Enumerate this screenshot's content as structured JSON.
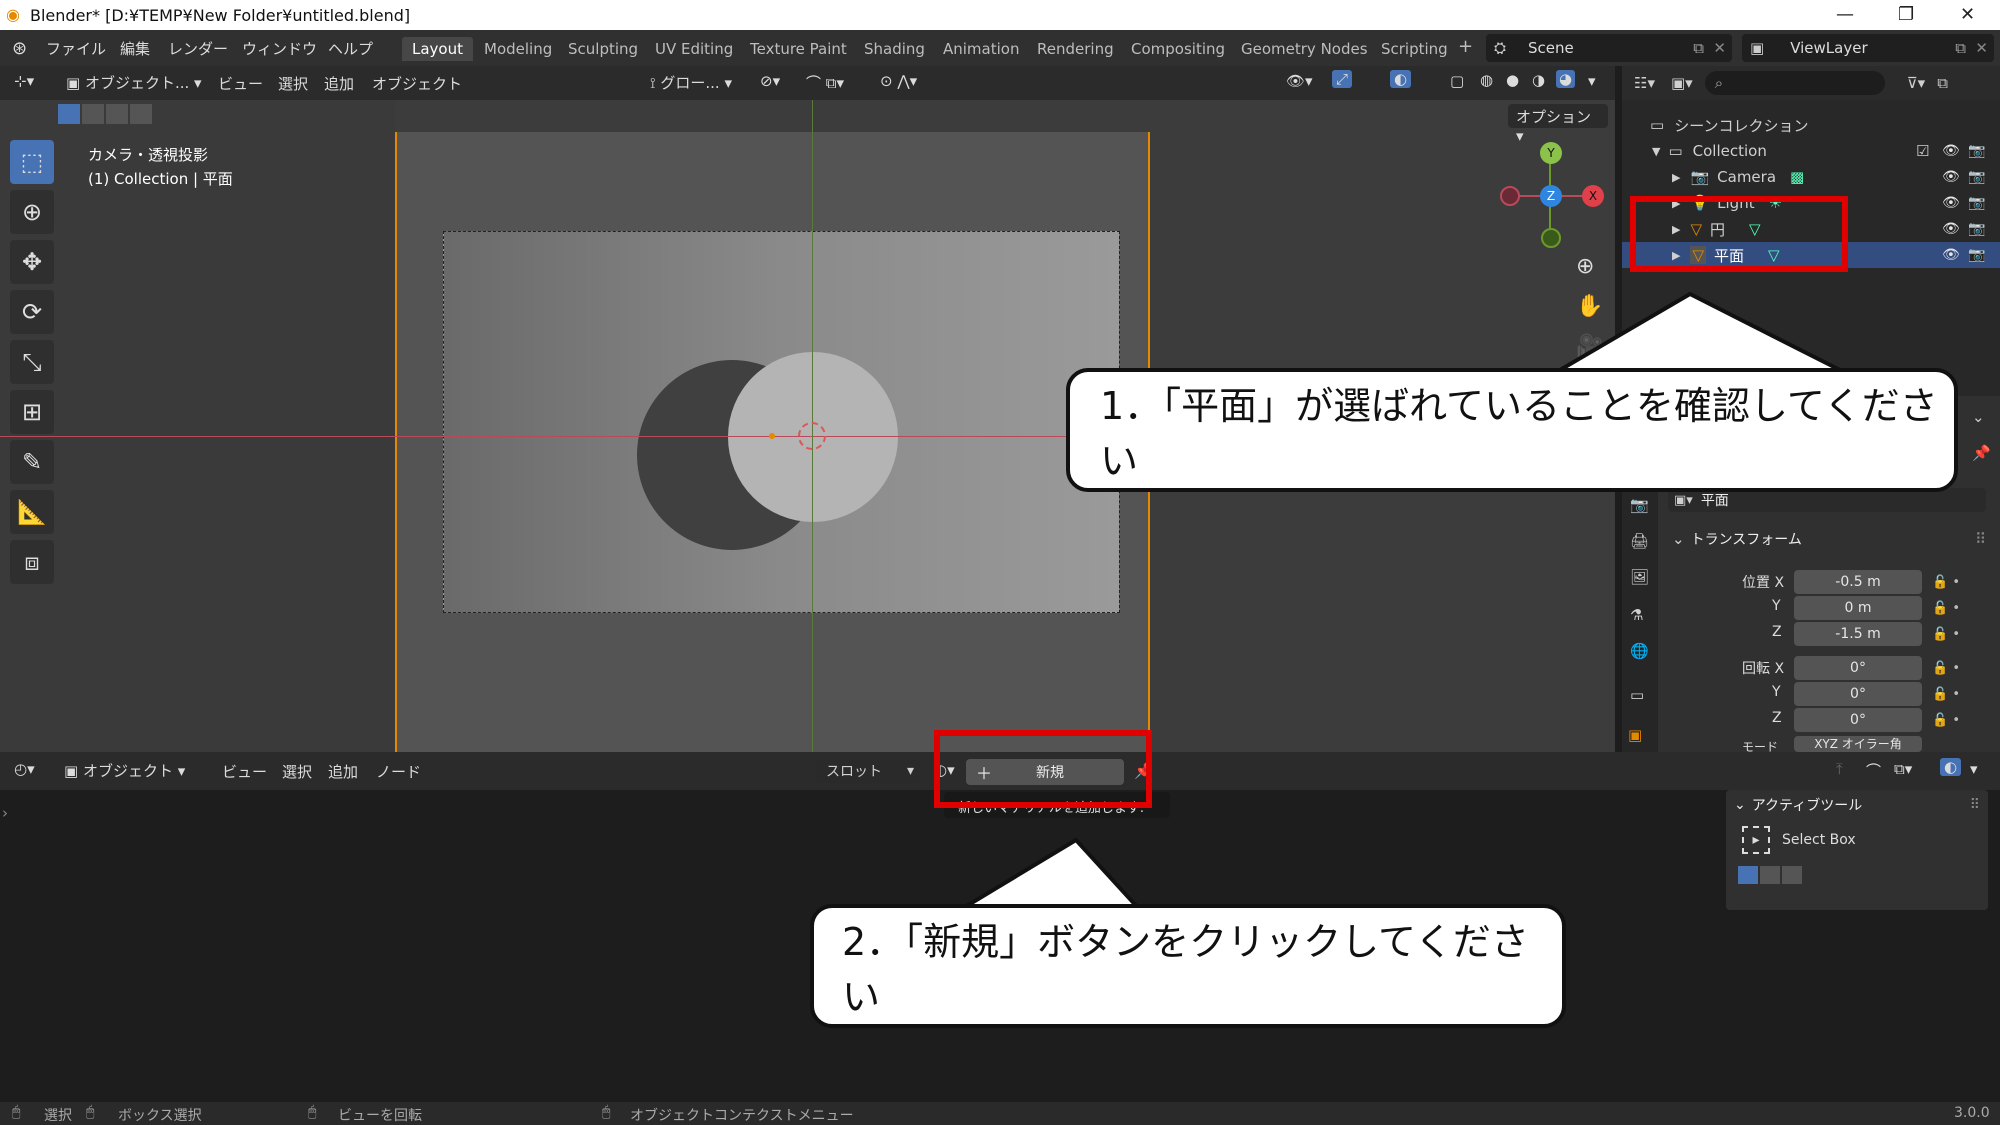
{
  "titlebar": {
    "title": "Blender* [D:¥TEMP¥New Folder¥untitled.blend]",
    "minimize": "—",
    "restore": "❐",
    "close": "✕"
  },
  "menu": {
    "items": [
      "ファイル",
      "編集",
      "レンダー",
      "ウィンドウ",
      "ヘルプ"
    ]
  },
  "workspaces": [
    "Layout",
    "Modeling",
    "Sculpting",
    "UV Editing",
    "Texture Paint",
    "Shading",
    "Animation",
    "Rendering",
    "Compositing",
    "Geometry Nodes",
    "Scripting"
  ],
  "workspace_add": "+",
  "scene": {
    "label": "Scene",
    "viewlayer": "ViewLayer"
  },
  "viewport_header": {
    "mode": "オブジェクト...",
    "view": "ビュー",
    "select": "選択",
    "add": "追加",
    "object": "オブジェクト",
    "transform": "グロー...",
    "options": "オプション"
  },
  "viewport": {
    "info_line1": "カメラ・透視投影",
    "info_line2": "(1) Collection | 平面"
  },
  "gizmo": {
    "y": "Y",
    "z": "Z",
    "x": "X"
  },
  "outliner": {
    "scene_collection": "シーンコレクション",
    "collection": "Collection",
    "items": [
      {
        "name": "Camera"
      },
      {
        "name": "Light"
      },
      {
        "name": "円"
      },
      {
        "name": "平面"
      }
    ]
  },
  "properties": {
    "object_name": "平面",
    "panel": "トランスフォーム",
    "loc_label": "位置 X",
    "rot_label": "回転 X",
    "y": "Y",
    "z": "Z",
    "loc": [
      "-0.5 m",
      "0 m",
      "-1.5 m"
    ],
    "rot": [
      "0°",
      "0°",
      "0°"
    ],
    "mode_label": "モード",
    "mode_value": "XYZ オイラー角"
  },
  "node_header": {
    "mode": "オブジェクト",
    "view": "ビュー",
    "select": "選択",
    "add": "追加",
    "node": "ノード",
    "slot": "スロット",
    "new_button": "新規",
    "tooltip": "新しいマテリアルを追加します."
  },
  "sidebar": {
    "active_tool": "アクティブツール",
    "select_box": "Select Box"
  },
  "status": {
    "select": "選択",
    "box_select": "ボックス選択",
    "rotate_view": "ビューを回転",
    "context_menu": "オブジェクトコンテクストメニュー",
    "version": "3.0.0"
  },
  "callouts": {
    "one": "1．「平面」が選ばれていることを確認してください",
    "two": "2．「新規」ボタンをクリックしてください"
  },
  "colors": {
    "accent": "#4772b3",
    "highlight": "#e00000",
    "orange": "#e58a00"
  }
}
